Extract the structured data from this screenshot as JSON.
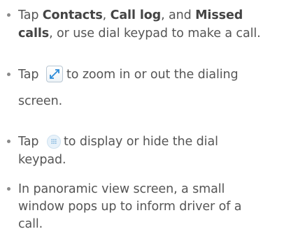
{
  "bullets": [
    {
      "lines": [
        [
          "Tap ",
          "Contacts",
          ", ",
          "Call log",
          ", and ",
          "Missed"
        ],
        [
          "calls",
          ", or use dial keypad to make a call."
        ]
      ]
    },
    {
      "pre_icon": "Tap ",
      "icon": "zoom-expand-icon",
      "post_icon": " to zoom in or out the dialing",
      "line2": "screen."
    },
    {
      "pre_icon": "Tap ",
      "icon": "dial-keypad-icon",
      "post_icon": " to display or hide the dial",
      "line2": "keypad."
    },
    {
      "lines": [
        "In panoramic view screen, a small",
        "window pops up to inform driver of a",
        "call."
      ]
    }
  ],
  "colors": {
    "text": "#555555",
    "bold": "#444444",
    "icon_accent": "#2a8ad8"
  }
}
